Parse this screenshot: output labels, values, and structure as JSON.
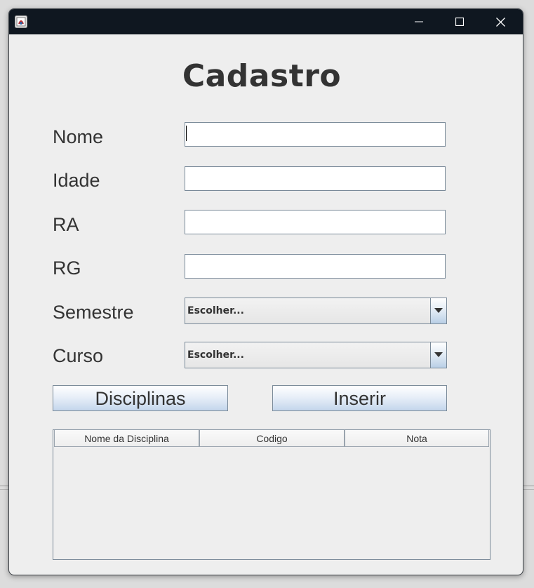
{
  "window": {
    "title": ""
  },
  "form": {
    "heading": "Cadastro",
    "fields": {
      "nome": {
        "label": "Nome",
        "value": ""
      },
      "idade": {
        "label": "Idade",
        "value": ""
      },
      "ra": {
        "label": "RA",
        "value": ""
      },
      "rg": {
        "label": "RG",
        "value": ""
      }
    },
    "semestre": {
      "label": "Semestre",
      "selected": "Escolher..."
    },
    "curso": {
      "label": "Curso",
      "selected": "Escolher..."
    }
  },
  "buttons": {
    "disciplinas": "Disciplinas",
    "inserir": "Inserir"
  },
  "table": {
    "columns": [
      "Nome da Disciplina",
      "Codigo",
      "Nota"
    ],
    "rows": []
  },
  "icons": {
    "app": "java-app-icon",
    "minimize": "minimize-icon",
    "maximize": "maximize-icon",
    "close": "close-icon",
    "dropdown": "chevron-down-icon"
  },
  "colors": {
    "titlebar": "#0f1720",
    "window_bg": "#eeeeee",
    "button_gradient_end": "#c4d6ec",
    "text": "#333333"
  }
}
